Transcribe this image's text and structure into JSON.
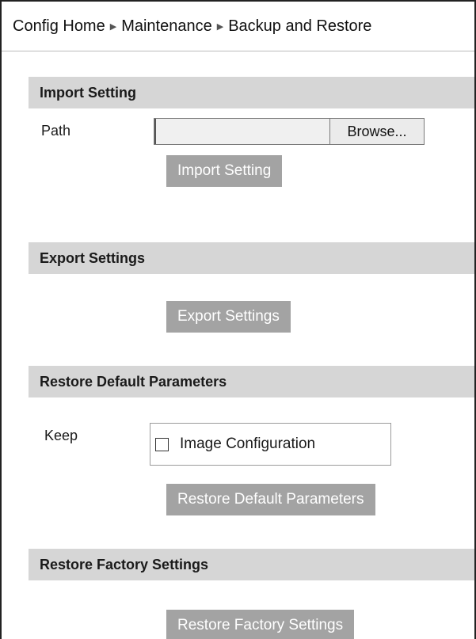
{
  "breadcrumb": {
    "items": [
      "Config Home",
      "Maintenance",
      "Backup and Restore"
    ],
    "separator": "▶"
  },
  "import_section": {
    "header": "Import Setting",
    "path_label": "Path",
    "path_value": "",
    "browse_label": "Browse...",
    "button_label": "Import Setting"
  },
  "export_section": {
    "header": "Export Settings",
    "button_label": "Export Settings"
  },
  "restore_default_section": {
    "header": "Restore Default Parameters",
    "keep_label": "Keep",
    "checkbox_label": "Image Configuration",
    "checkbox_checked": false,
    "button_label": "Restore Default Parameters"
  },
  "restore_factory_section": {
    "header": "Restore Factory Settings",
    "button_label": "Restore Factory Settings"
  },
  "colors": {
    "section_header_bg": "#d6d6d6",
    "button_bg": "#a3a3a3",
    "button_text": "#ffffff"
  }
}
